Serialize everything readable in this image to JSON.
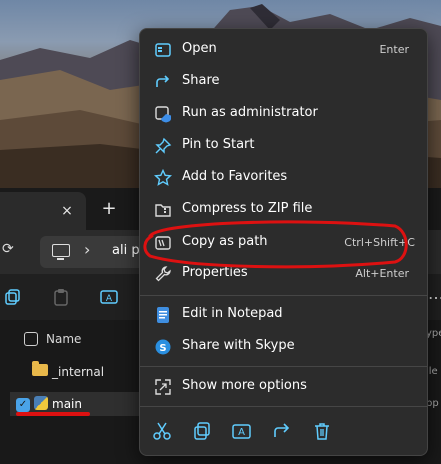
{
  "explorer": {
    "tab_close": "×",
    "new_tab": "+",
    "refresh": "⟳",
    "breadcrumb_sep": "›",
    "breadcrumb": "ali p",
    "more": "…",
    "list": {
      "header_name": "Name",
      "rows": [
        {
          "name": "_internal",
          "type": "folder"
        },
        {
          "name": "main",
          "type": "python-file",
          "selected": true
        }
      ]
    },
    "side_fragments": [
      "ype",
      "ile",
      "pp"
    ]
  },
  "context_menu": {
    "items": [
      {
        "label": "Open",
        "shortcut": "Enter",
        "icon": "open-window-icon"
      },
      {
        "label": "Share",
        "shortcut": "",
        "icon": "share-icon"
      },
      {
        "label": "Run as administrator",
        "shortcut": "",
        "icon": "shield-admin-icon"
      },
      {
        "label": "Pin to Start",
        "shortcut": "",
        "icon": "pin-icon"
      },
      {
        "label": "Add to Favorites",
        "shortcut": "",
        "icon": "star-icon"
      },
      {
        "label": "Compress to ZIP file",
        "shortcut": "",
        "icon": "zip-icon"
      },
      {
        "label": "Copy as path",
        "shortcut": "Ctrl+Shift+C",
        "icon": "copy-path-icon"
      },
      {
        "label": "Properties",
        "shortcut": "Alt+Enter",
        "icon": "wrench-icon"
      },
      {
        "label": "Edit in Notepad",
        "shortcut": "",
        "icon": "notepad-icon"
      },
      {
        "label": "Share with Skype",
        "shortcut": "",
        "icon": "skype-icon"
      },
      {
        "label": "Show more options",
        "shortcut": "",
        "icon": "more-options-icon"
      }
    ],
    "bottom_actions": [
      "cut-icon",
      "copy-icon",
      "rename-icon",
      "share-icon",
      "delete-icon"
    ]
  },
  "colors": {
    "accent": "#60cdff",
    "annotation": "#dd1111",
    "menu_bg": "#2c2c2c"
  }
}
